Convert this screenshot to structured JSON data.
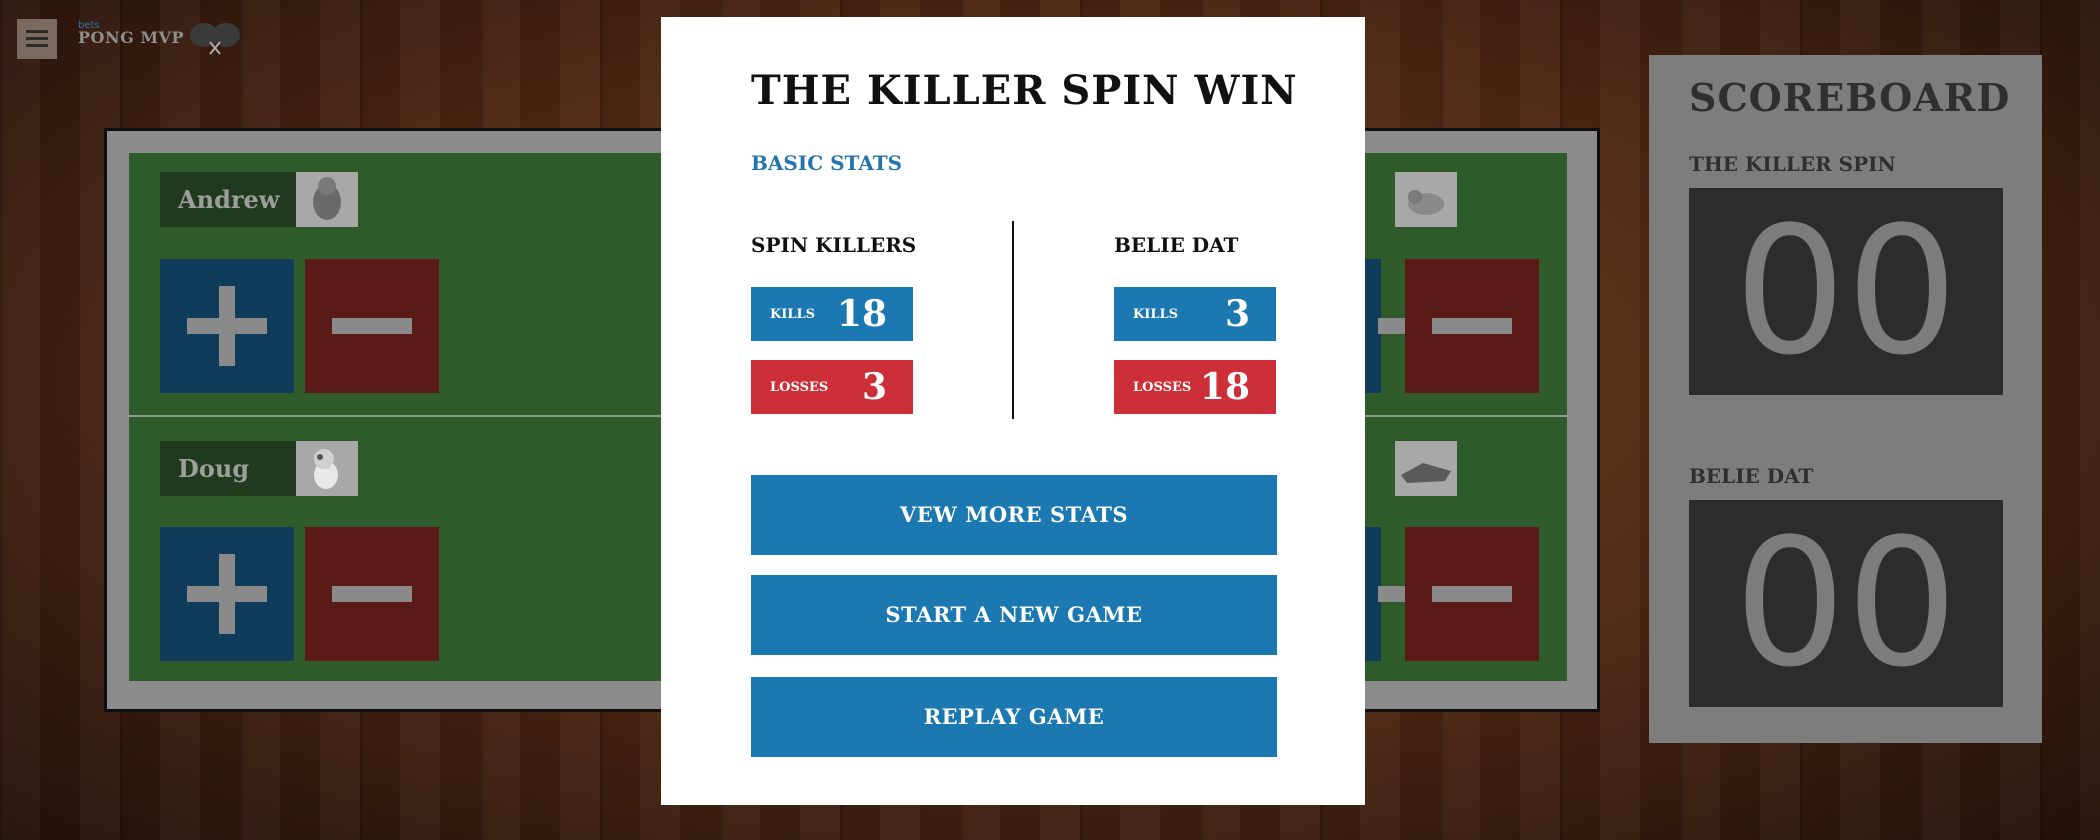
{
  "header": {
    "brand_small": "bets",
    "brand": "PONG MVP"
  },
  "table": {
    "left_players": [
      {
        "name": "Andrew",
        "avatar": "cartoon-character"
      },
      {
        "name": "Doug",
        "avatar": "puppy"
      }
    ],
    "right_players": [
      {
        "avatar": "cat"
      },
      {
        "avatar": "shoes"
      }
    ]
  },
  "scoreboard": {
    "title": "SCOREBOARD",
    "teams": [
      {
        "name": "THE KILLER SPIN",
        "score": "00"
      },
      {
        "name": "BELIE DAT",
        "score": "00"
      }
    ]
  },
  "modal": {
    "title": "THE KILLER SPIN WIN",
    "section_label": "BASIC STATS",
    "teams": [
      {
        "name": "SPIN KILLERS",
        "kills_label": "KILLS",
        "kills": "18",
        "losses_label": "LOSSES",
        "losses": "3"
      },
      {
        "name": "BELIE DAT",
        "kills_label": "KILLS",
        "kills": "3",
        "losses_label": "LOSSES",
        "losses": "18"
      }
    ],
    "buttons": {
      "more_stats": "VEW MORE STATS",
      "new_game": "START A NEW GAME",
      "replay": "REPLAY GAME"
    }
  },
  "colors": {
    "primary": "#1b78b0",
    "danger": "#cc2f37",
    "court": "#2f5a2a"
  }
}
